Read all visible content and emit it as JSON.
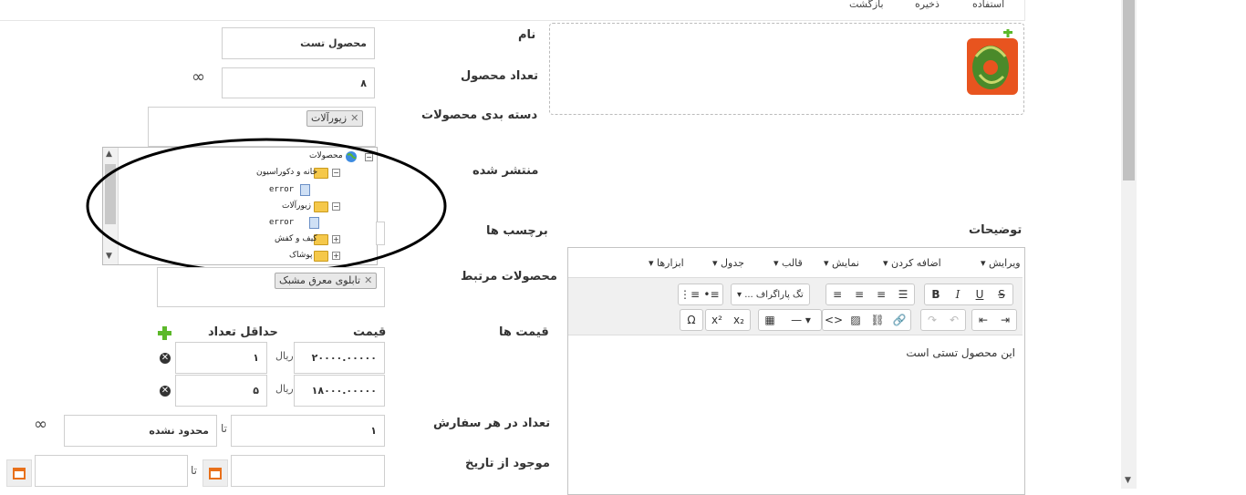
{
  "topbar": {
    "use": "استفاده",
    "save": "ذخیره",
    "back": "بازگشت"
  },
  "form": {
    "name_label": "نام",
    "name_value": "محصول تست",
    "count_label": "تعداد محصول",
    "count_value": "۸",
    "infinity": "∞",
    "category_label": "دسته بدی محصولات",
    "category_tag": "زیورآلات",
    "published_label": "منتشر شده",
    "tags_label": "برچسب ها",
    "related_label": "محصولات مرتبط",
    "related_tag": "تابلوی معرق مشبک",
    "price_label": "قیمت ها",
    "price_header": "قیمت",
    "minqty_header": "حداقل تعداد",
    "prices": [
      {
        "price": "۲۰۰۰۰.۰۰۰۰۰",
        "currency": "ریال",
        "min": "۱"
      },
      {
        "price": "۱۸۰۰۰.۰۰۰۰۰",
        "currency": "ریال",
        "min": "۵"
      }
    ],
    "order_label": "تعداد در هر سفارش",
    "order_from": "۱",
    "order_to_label": "تا",
    "order_to": "محدود نشده",
    "date_label": "موجود از تاریخ",
    "date_to_label": "تا",
    "desc_label": "توضیحات"
  },
  "tree": {
    "root": "محصولات",
    "items": [
      "خانه و دکوراسیون",
      "error",
      "زیورآلات",
      "error",
      "کیف و کفش",
      "پوشاک"
    ]
  },
  "editor": {
    "menus": [
      "ویرایش",
      "اضافه کردن",
      "نمایش",
      "قالب",
      "جدول",
      "ابزارها"
    ],
    "paragraph_tag": "تگ پاراگراف ...",
    "content": "این محصول تستی است"
  }
}
